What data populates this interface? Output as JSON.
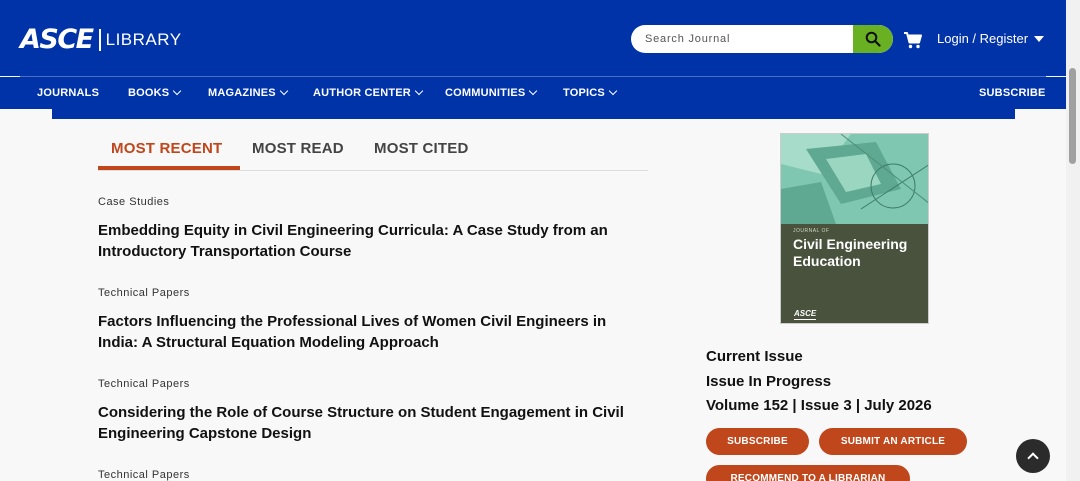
{
  "header": {
    "logo_text": "ASCE",
    "logo_sub": "LIBRARY",
    "search_placeholder": "Search Journal",
    "login_label": "Login / Register"
  },
  "nav": {
    "items": [
      {
        "label": "JOURNALS",
        "has_dropdown": false
      },
      {
        "label": "BOOKS",
        "has_dropdown": true
      },
      {
        "label": "MAGAZINES",
        "has_dropdown": true
      },
      {
        "label": "AUTHOR CENTER",
        "has_dropdown": true
      },
      {
        "label": "COMMUNITIES",
        "has_dropdown": true
      },
      {
        "label": "TOPICS",
        "has_dropdown": true
      }
    ],
    "subscribe_label": "SUBSCRIBE"
  },
  "tabs": [
    {
      "label": "MOST RECENT",
      "active": true
    },
    {
      "label": "MOST READ",
      "active": false
    },
    {
      "label": "MOST CITED",
      "active": false
    }
  ],
  "articles": [
    {
      "type": "Case Studies",
      "title": "Embedding Equity in Civil Engineering Curricula: A Case Study from an Introductory Transportation Course"
    },
    {
      "type": "Technical Papers",
      "title": "Factors Influencing the Professional Lives of Women Civil Engineers in India: A Structural Equation Modeling Approach"
    },
    {
      "type": "Technical Papers",
      "title": "Considering the Role of Course Structure on Student Engagement in Civil Engineering Capstone Design"
    },
    {
      "type": "Technical Papers",
      "title": ""
    }
  ],
  "journal": {
    "cover_small": "JOURNAL OF",
    "cover_title": "Civil Engineering Education",
    "cover_logo": "ASCE",
    "current_issue": "Current Issue",
    "issue_in_progress": "Issue In Progress",
    "volume": "Volume 152 | Issue 3 | July 2026",
    "buttons": {
      "subscribe": "SUBSCRIBE",
      "submit": "SUBMIT AN ARTICLE",
      "recommend": "RECOMMEND TO A LIBRARIAN"
    }
  },
  "colors": {
    "brand_blue": "#0033a8",
    "accent_orange": "#c0461b",
    "search_green": "#6ab023",
    "cover_green": "#49523d"
  },
  "icons": [
    "search-icon",
    "cart-icon",
    "caret-down-icon",
    "chevron-down-icon",
    "chevron-up-icon"
  ]
}
